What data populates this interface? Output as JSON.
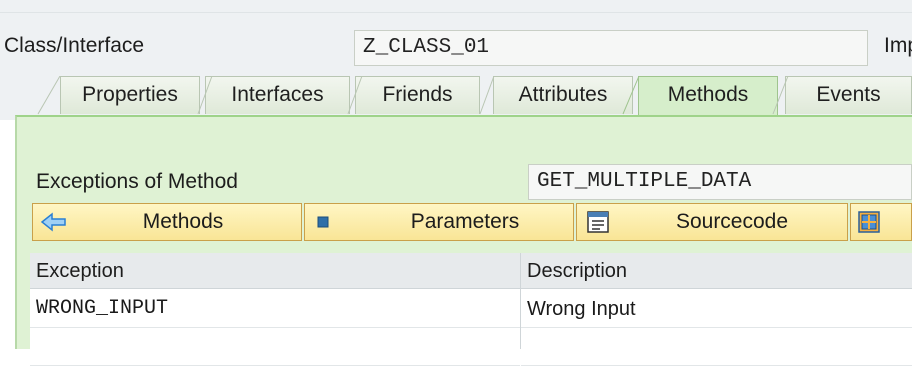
{
  "header": {
    "class_label": "Class/Interface",
    "class_value": "Z_CLASS_01",
    "cut_label": "Imple"
  },
  "tabs": [
    {
      "label": "Properties",
      "active": false
    },
    {
      "label": "Interfaces",
      "active": false
    },
    {
      "label": "Friends",
      "active": false
    },
    {
      "label": "Attributes",
      "active": false
    },
    {
      "label": "Methods",
      "active": true
    },
    {
      "label": "Events",
      "active": false
    }
  ],
  "panel": {
    "exceptions_label": "Exceptions of Method",
    "method_value": "GET_MULTIPLE_DATA"
  },
  "toolbar": {
    "methods_label": "Methods",
    "parameters_label": "Parameters",
    "sourcecode_label": "Sourcecode"
  },
  "table": {
    "columns": [
      "Exception",
      "Description"
    ],
    "rows": [
      {
        "exception": "WRONG_INPUT",
        "description": "Wrong Input"
      }
    ]
  },
  "colors": {
    "panel_green": "#dff2d4",
    "active_tab": "#d6eecb",
    "button_yellow": "#f9e596",
    "arrow_blue": "#2a7fd3"
  },
  "icons": [
    "back-arrow-icon",
    "square-icon",
    "source-code-icon",
    "grid-icon"
  ]
}
